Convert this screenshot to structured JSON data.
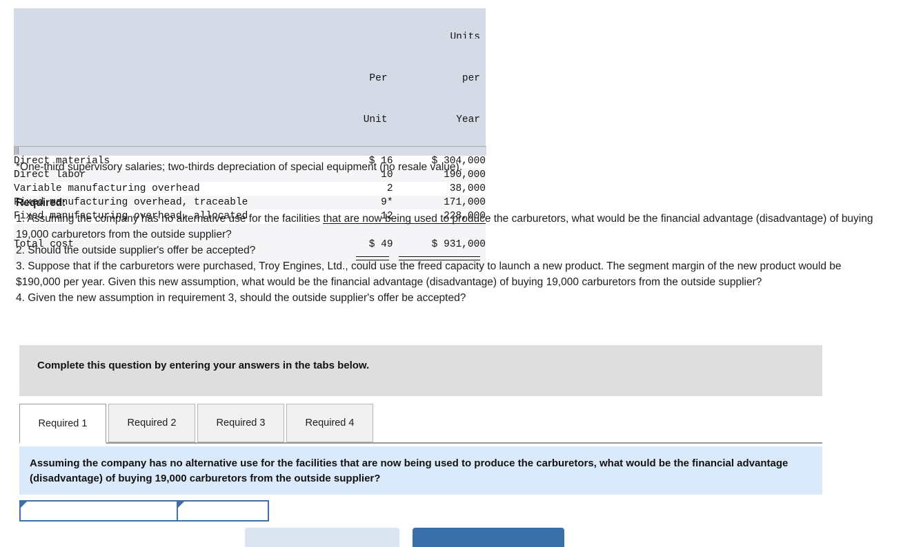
{
  "cost_table": {
    "headers": {
      "label": "",
      "clipped_top": "Units",
      "per_unit_line1": "Per",
      "per_unit_line2": "Unit",
      "per_year_line1": "per",
      "per_year_line2": "Year"
    },
    "rows": [
      {
        "label": "Direct materials",
        "per_unit": "$ 16",
        "per_year": "$ 304,000"
      },
      {
        "label": "Direct labor",
        "per_unit": "10",
        "per_year": "190,000"
      },
      {
        "label": "Variable manufacturing overhead",
        "per_unit": "2",
        "per_year": "38,000"
      },
      {
        "label": "Fixed manufacturing overhead, traceable",
        "per_unit": "9*",
        "per_year": "171,000"
      },
      {
        "label": "Fixed manufacturing overhead, allocated",
        "per_unit": "12",
        "per_year": "228,000"
      }
    ],
    "total": {
      "label": "Total cost",
      "per_unit": "$ 49",
      "per_year": "$ 931,000"
    }
  },
  "footnote": "*One-third supervisory salaries; two-thirds depreciation of special equipment (no resale value).",
  "required": {
    "heading": "Required:",
    "items": [
      "1. Assuming the company has no alternative use for the facilities that are now being used to produce the carburetors, what would be the financial advantage (disadvantage) of buying 19,000 carburetors from the outside supplier?",
      "2. Should the outside supplier's offer be accepted?",
      "3. Suppose that if the carburetors were purchased, Troy Engines, Ltd., could use the freed capacity to launch a new product. The segment margin of the new product would be $190,000 per year. Given this new assumption, what would be the financial advantage (disadvantage) of buying 19,000 carburetors from the outside supplier?",
      "4. Given the new assumption in requirement 3, should the outside supplier's offer be accepted?"
    ]
  },
  "banner": {
    "text": "Complete this question by entering your answers in the tabs below."
  },
  "tabs": [
    {
      "label": "Required 1",
      "active": true
    },
    {
      "label": "Required 2",
      "active": false
    },
    {
      "label": "Required 3",
      "active": false
    },
    {
      "label": "Required 4",
      "active": false
    }
  ],
  "question_panel": {
    "text": "Assuming the company has no alternative use for the facilities that are now being used to produce the carburetors, what would be the financial advantage (disadvantage) of buying 19,000 carburetors from the outside supplier?"
  },
  "answer_inputs": [
    {
      "value": "",
      "placeholder": ""
    },
    {
      "value": "",
      "placeholder": ""
    }
  ],
  "bottom_buttons": {
    "prev_label": "",
    "next_label": ""
  },
  "colors": {
    "table_header_bg": "#d4dae6",
    "row_alt_bg": "#f5f5f7",
    "banner_bg": "#dedede",
    "question_panel_bg": "#dbeafa",
    "input_border": "#3f6fa8",
    "next_button_bg": "#3a6ea8",
    "prev_button_bg": "#dbe5f1"
  }
}
